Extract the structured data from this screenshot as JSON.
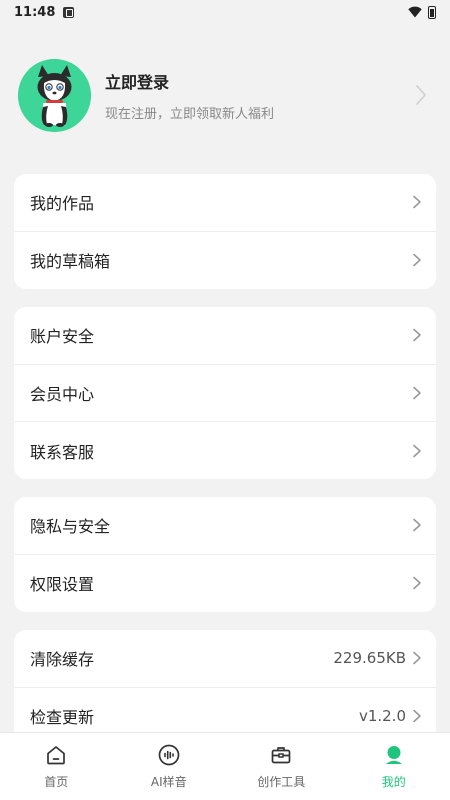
{
  "status_bar": {
    "time": "11:48"
  },
  "profile": {
    "title": "立即登录",
    "subtitle": "现在注册，立即领取新人福利"
  },
  "groups": [
    {
      "items": [
        {
          "label": "我的作品"
        },
        {
          "label": "我的草稿箱"
        }
      ]
    },
    {
      "items": [
        {
          "label": "账户安全"
        },
        {
          "label": "会员中心"
        },
        {
          "label": "联系客服"
        }
      ]
    },
    {
      "items": [
        {
          "label": "隐私与安全"
        },
        {
          "label": "权限设置"
        }
      ]
    },
    {
      "items": [
        {
          "label": "清除缓存",
          "value": "229.65KB"
        },
        {
          "label": "检查更新",
          "value": "v1.2.0"
        }
      ]
    }
  ],
  "tabbar": {
    "tabs": [
      {
        "label": "首页",
        "icon": "home-icon"
      },
      {
        "label": "AI样音",
        "icon": "voice-icon"
      },
      {
        "label": "创作工具",
        "icon": "toolbox-icon"
      },
      {
        "label": "我的",
        "icon": "profile-icon"
      }
    ],
    "active_index": 3
  },
  "colors": {
    "accent": "#1fc57c",
    "avatar_bg": "#3dd598",
    "background": "#f2f2f2"
  }
}
